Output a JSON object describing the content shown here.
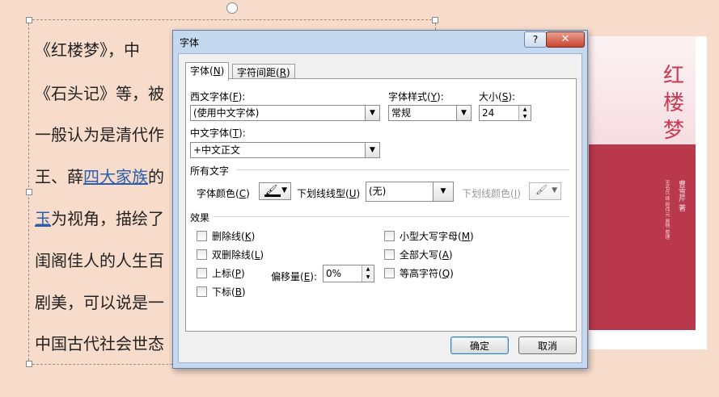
{
  "slide": {
    "lines": [
      {
        "text": "《红楼梦》，中"
      },
      {
        "text": "《石头记》等，被"
      },
      {
        "text": "一般认为是清代作"
      },
      {
        "pre": "王、薛",
        "link": "四大家族",
        "post": "的"
      },
      {
        "link": "玉",
        "post": "为视角，描绘了"
      },
      {
        "text": "闺阁佳人的人生百"
      },
      {
        "text": "剧美，可以说是一"
      },
      {
        "text": "中国古代社会世态"
      }
    ]
  },
  "book": {
    "title": "红楼梦",
    "author": "曹雪芹 著",
    "sub": "无名氏 续 程伟元 高鹗 整理"
  },
  "dialog": {
    "title": "字体",
    "help": "?",
    "close": "✕",
    "tabs": [
      {
        "label": "字体(",
        "key": "N",
        "end": ")"
      },
      {
        "label": "字符间距(",
        "key": "R",
        "end": ")"
      }
    ],
    "western_font": {
      "label": "西文字体(",
      "key": "F",
      "end": "):",
      "value": "(使用中文字体)"
    },
    "font_style": {
      "label": "字体样式(",
      "key": "Y",
      "end": "):",
      "value": "常规"
    },
    "size": {
      "label": "大小(",
      "key": "S",
      "end": "):",
      "value": "24"
    },
    "chinese_font": {
      "label": "中文字体(",
      "key": "T",
      "end": "):",
      "value": "+中文正文"
    },
    "all_text_header": "所有文字",
    "font_color": {
      "label": "字体颜色(",
      "key": "C",
      "end": ")"
    },
    "underline_style": {
      "label": "下划线线型(",
      "key": "U",
      "end": ")",
      "value": "(无)"
    },
    "underline_color": {
      "label": "下划线颜色(",
      "key": "I",
      "end": ")"
    },
    "effects_header": "效果",
    "effects_left": [
      {
        "label": "删除线(",
        "key": "K",
        "end": ")"
      },
      {
        "label": "双删除线(",
        "key": "L",
        "end": ")"
      },
      {
        "label": "上标(",
        "key": "P",
        "end": ")"
      },
      {
        "label": "下标(",
        "key": "B",
        "end": ")"
      }
    ],
    "effects_right": [
      {
        "label": "小型大写字母(",
        "key": "M",
        "end": ")"
      },
      {
        "label": "全部大写(",
        "key": "A",
        "end": ")"
      },
      {
        "label": "等高字符(",
        "key": "Q",
        "end": ")"
      }
    ],
    "offset": {
      "label": "偏移量(",
      "key": "E",
      "end": "):",
      "value": "0%"
    },
    "ok": "确定",
    "cancel": "取消"
  }
}
